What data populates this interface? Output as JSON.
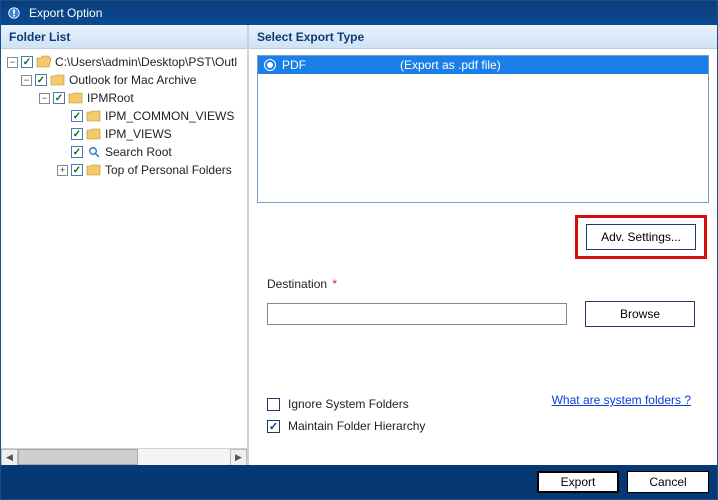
{
  "title": "Export Option",
  "leftPane": {
    "header": "Folder List",
    "tree": {
      "root": {
        "label": "C:\\Users\\admin\\Desktop\\PST\\Outl"
      },
      "n1": {
        "label": "Outlook for Mac Archive"
      },
      "n2": {
        "label": "IPMRoot"
      },
      "n3a": {
        "label": "IPM_COMMON_VIEWS"
      },
      "n3b": {
        "label": "IPM_VIEWS"
      },
      "n3c": {
        "label": "Search Root"
      },
      "n3d": {
        "label": "Top of Personal Folders"
      }
    }
  },
  "rightPane": {
    "header": "Select Export Type",
    "exportTypes": {
      "selected": {
        "name": "PDF",
        "desc": "(Export as .pdf file)"
      }
    },
    "advButton": "Adv. Settings...",
    "destination": {
      "label": "Destination",
      "required": "*",
      "value": "",
      "browse": "Browse"
    },
    "options": {
      "ignoreSystem": {
        "label": "Ignore System Folders",
        "checked": false
      },
      "maintainHierarchy": {
        "label": "Maintain Folder Hierarchy",
        "checked": true
      },
      "helpLink": "What are system folders ?"
    }
  },
  "footer": {
    "export": "Export",
    "cancel": "Cancel"
  }
}
